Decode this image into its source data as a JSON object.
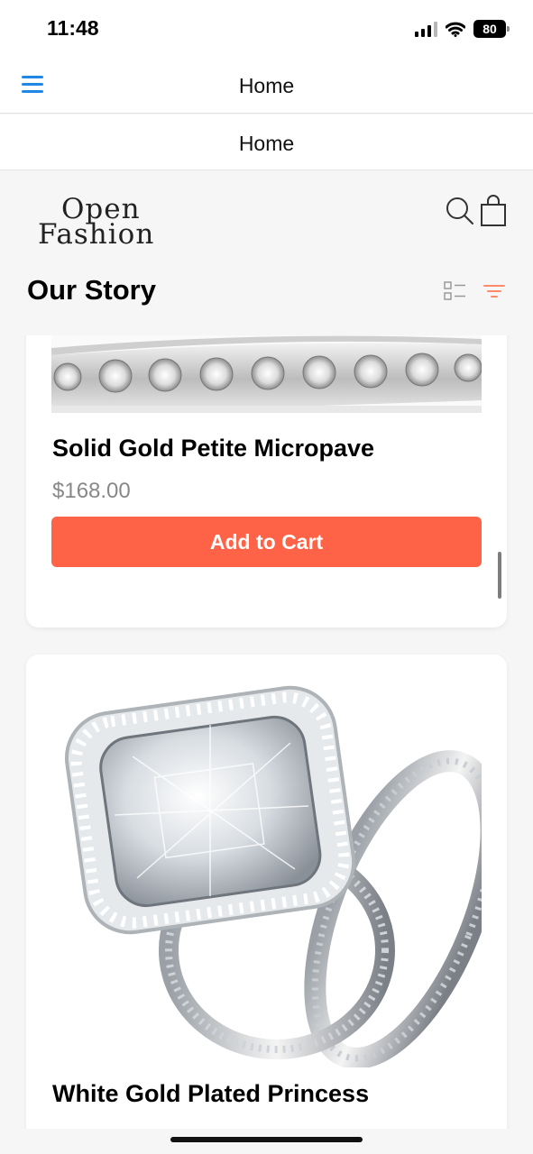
{
  "status_bar": {
    "time": "11:48",
    "battery": "80"
  },
  "header": {
    "title": "Home",
    "menu_icon": "hamburger-menu-icon"
  },
  "sub_header": {
    "title": "Home"
  },
  "brand": {
    "logo_line1": "Open",
    "logo_line2": "Fashion"
  },
  "toolbar": {
    "search_icon": "search-icon",
    "bag_icon": "shopping-bag-icon"
  },
  "page": {
    "title": "Our Story",
    "view_icon": "list-view-icon",
    "filter_icon": "filter-icon"
  },
  "colors": {
    "accent": "#ff6347",
    "price": "#888888",
    "menu_icon": "#1e88e5",
    "filter_icon": "#ff8a6b"
  },
  "products": [
    {
      "name": "Solid Gold Petite Micropave",
      "price": "$168.00",
      "cta": "Add to Cart",
      "image": "diamond-band-ring-image"
    },
    {
      "name": "White Gold Plated Princess",
      "image": "cushion-cut-engagement-ring-set-image"
    }
  ]
}
